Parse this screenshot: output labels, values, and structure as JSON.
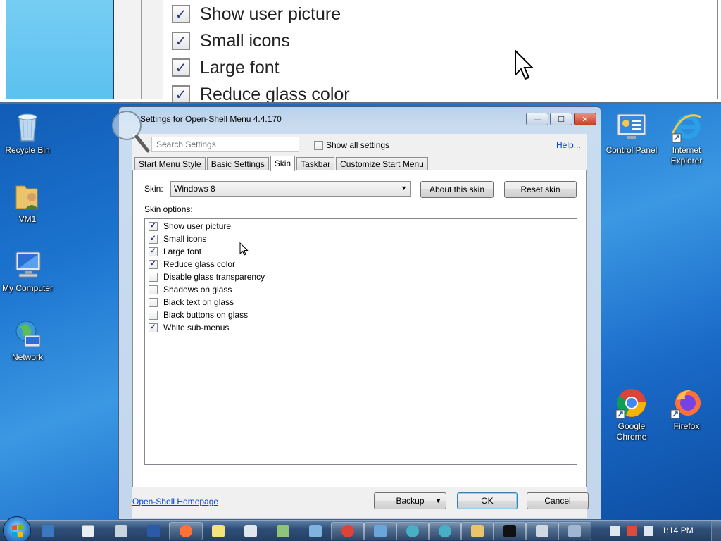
{
  "magnifier": {
    "items": [
      {
        "label": "Show user picture",
        "checked": true
      },
      {
        "label": "Small icons",
        "checked": true
      },
      {
        "label": "Large font",
        "checked": true
      },
      {
        "label": "Reduce glass color",
        "checked": true
      }
    ]
  },
  "desktop": {
    "icons_left": [
      {
        "label": "Recycle Bin",
        "icon": "recycle-bin-icon"
      },
      {
        "label": "VM1",
        "icon": "user-folder-icon"
      },
      {
        "label": "My Computer",
        "icon": "computer-icon"
      },
      {
        "label": "Network",
        "icon": "network-icon"
      }
    ],
    "icons_right": [
      {
        "label": "Control Panel",
        "icon": "control-panel-icon"
      },
      {
        "label": "Internet Explorer",
        "icon": "internet-explorer-icon"
      },
      {
        "label": "Google Chrome",
        "icon": "chrome-icon"
      },
      {
        "label": "Firefox",
        "icon": "firefox-icon"
      }
    ]
  },
  "window": {
    "title": "Settings for Open-Shell Menu 4.4.170",
    "buttons": {
      "minimize": "—",
      "maximize": "☐",
      "close": "✕"
    }
  },
  "toolbar": {
    "search_placeholder": "Search Settings",
    "show_all_label": "Show all settings",
    "show_all_checked": false,
    "help_label": "Help..."
  },
  "tabs": [
    {
      "label": "Start Menu Style",
      "active": false
    },
    {
      "label": "Basic Settings",
      "active": false
    },
    {
      "label": "Skin",
      "active": true
    },
    {
      "label": "Taskbar",
      "active": false
    },
    {
      "label": "Customize Start Menu",
      "active": false
    }
  ],
  "skin": {
    "label": "Skin:",
    "selected": "Windows 8",
    "about_button": "About this skin",
    "reset_button": "Reset skin",
    "options_label": "Skin options:",
    "options": [
      {
        "label": "Show user picture",
        "checked": true
      },
      {
        "label": "Small icons",
        "checked": true
      },
      {
        "label": "Large font",
        "checked": true
      },
      {
        "label": "Reduce glass color",
        "checked": true
      },
      {
        "label": "Disable glass transparency",
        "checked": false
      },
      {
        "label": "Shadows on glass",
        "checked": false
      },
      {
        "label": "Black text on glass",
        "checked": false
      },
      {
        "label": "Black buttons on glass",
        "checked": false
      },
      {
        "label": "White sub-menus",
        "checked": true
      }
    ]
  },
  "footer": {
    "homepage_link": "Open-Shell Homepage",
    "backup_button": "Backup",
    "ok_button": "OK",
    "cancel_button": "Cancel"
  },
  "taskbar": {
    "clock": "1:14 PM"
  }
}
